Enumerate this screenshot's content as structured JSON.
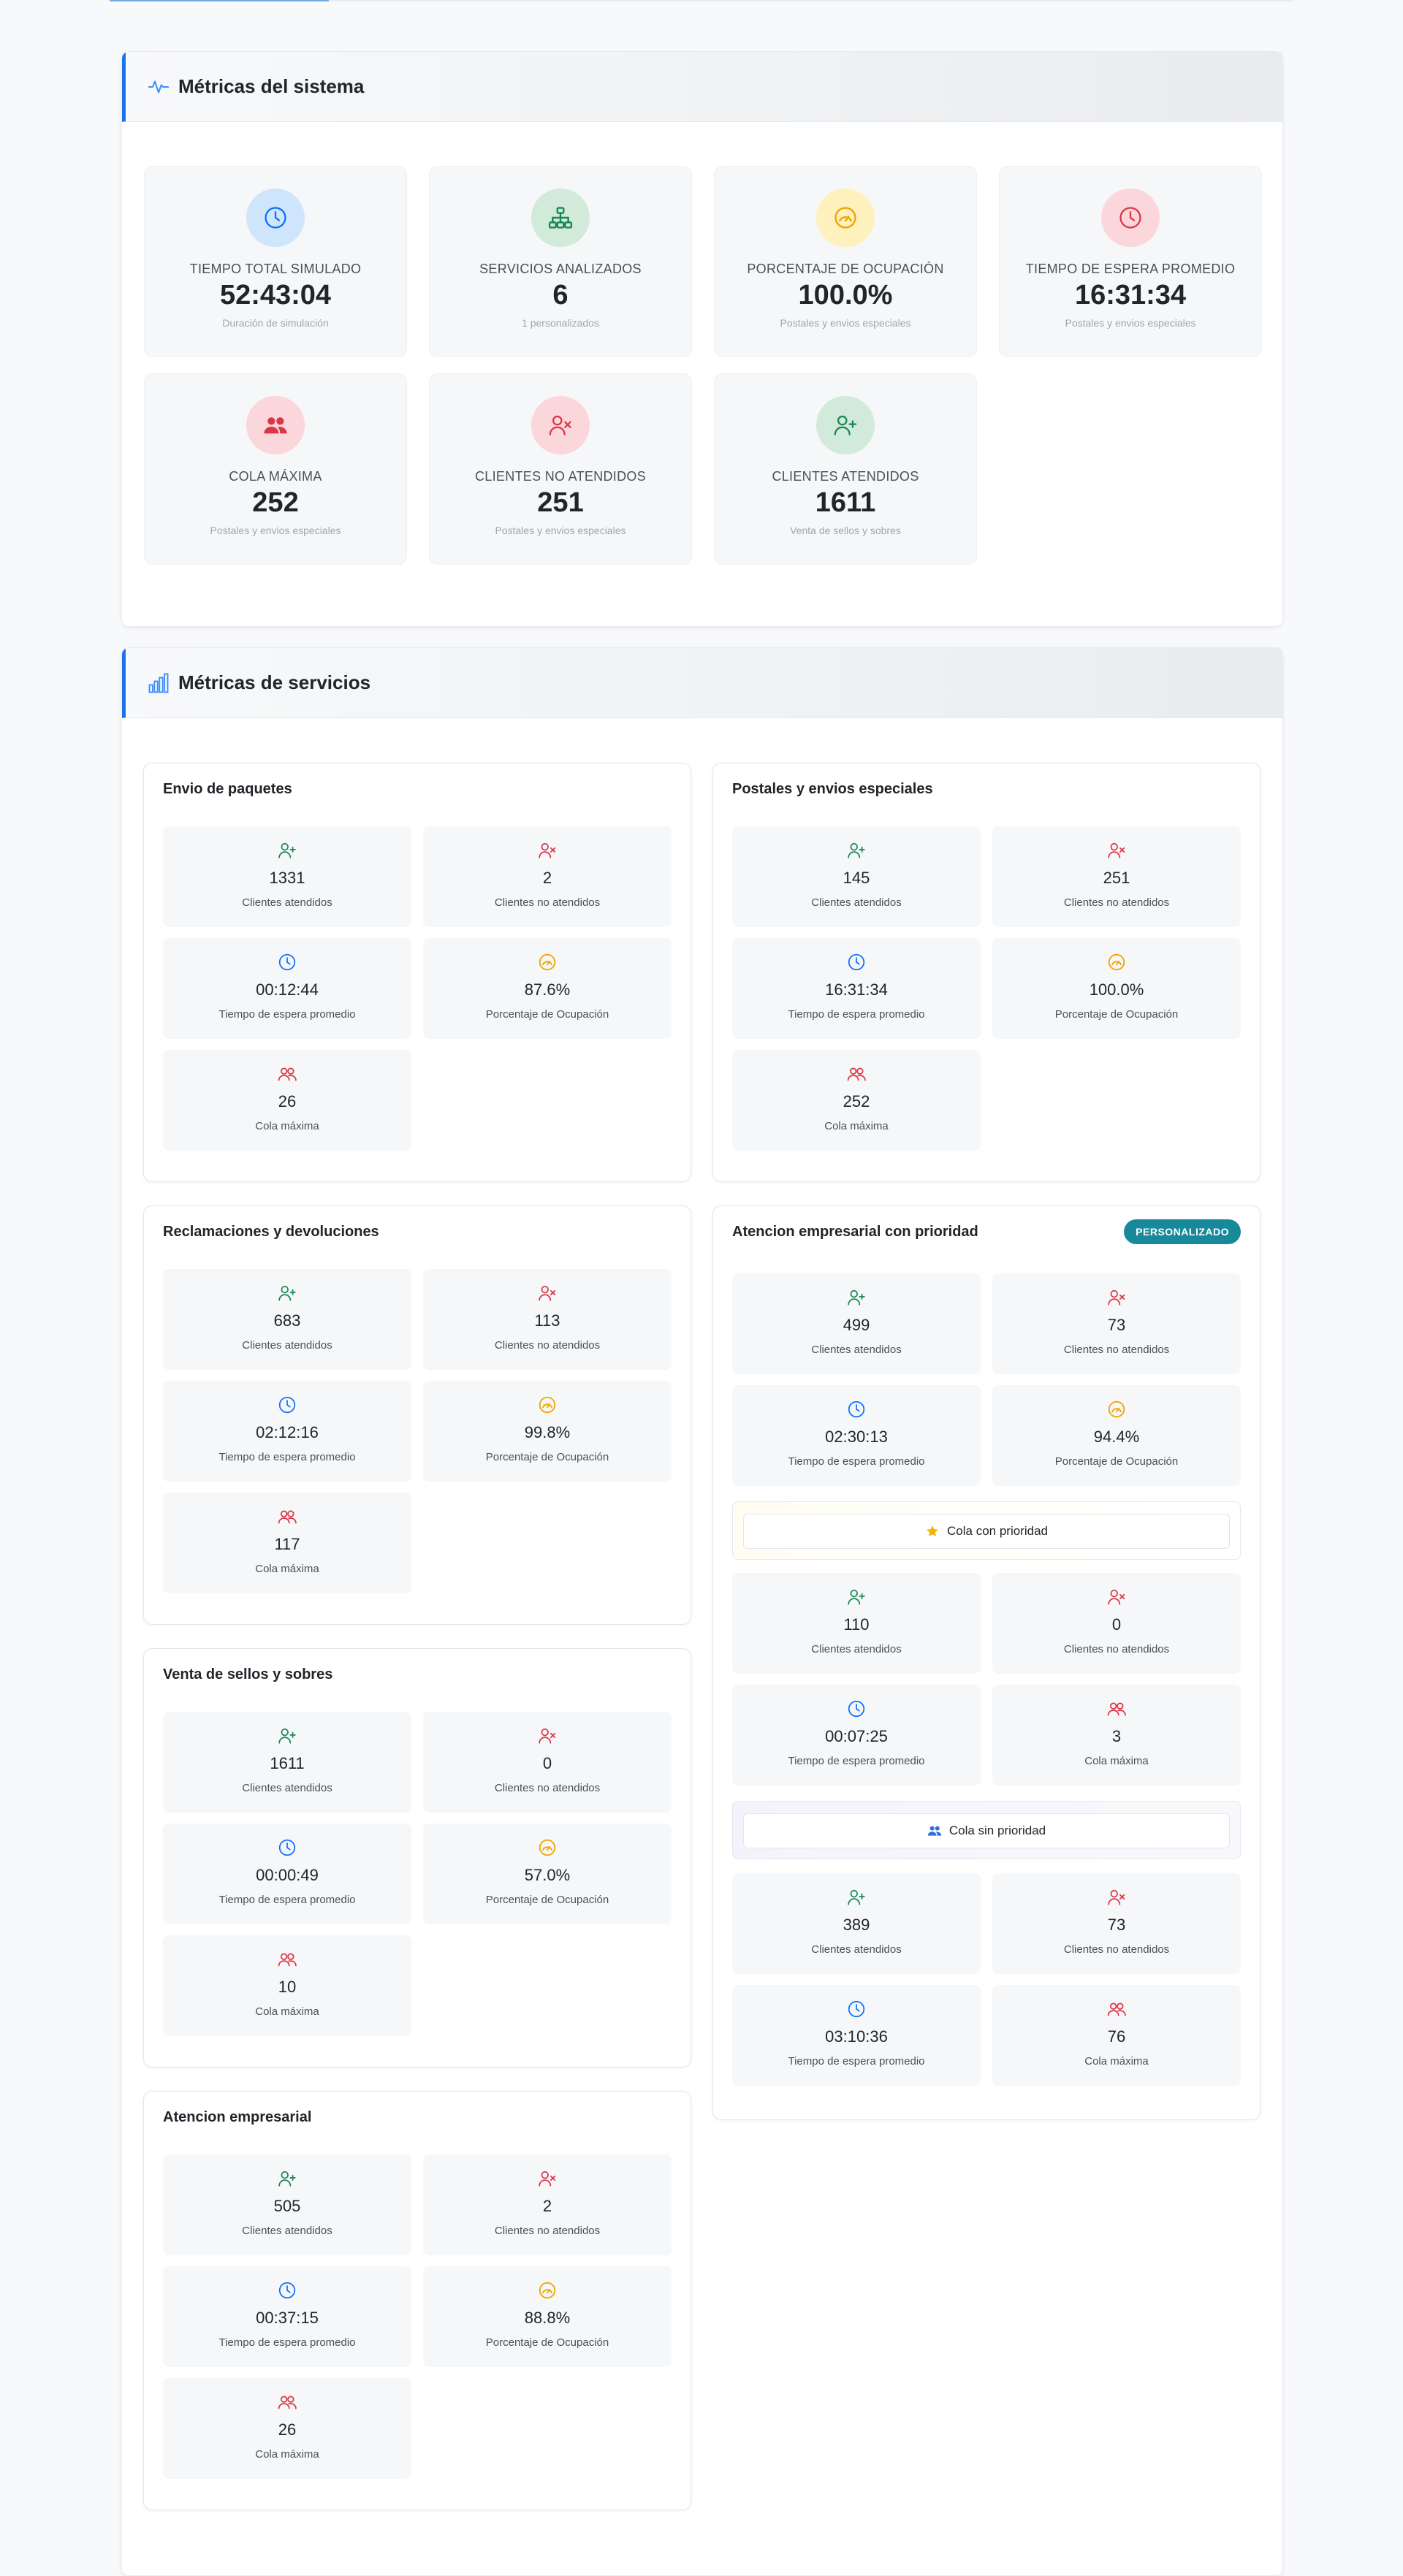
{
  "system": {
    "title": "Métricas del sistema",
    "tiles": [
      {
        "icon": "clock-icon",
        "label": "TIEMPO TOTAL SIMULADO",
        "value": "52:43:04",
        "sub": "Duración de simulación"
      },
      {
        "icon": "sitemap-icon",
        "label": "SERVICIOS ANALIZADOS",
        "value": "6",
        "sub": "1 personalizados"
      },
      {
        "icon": "gauge-icon",
        "label": "PORCENTAJE DE OCUPACIÓN",
        "value": "100.0%",
        "sub": "Postales y envios especiales"
      },
      {
        "icon": "clock-icon",
        "label": "TIEMPO DE ESPERA PROMEDIO",
        "value": "16:31:34",
        "sub": "Postales y envios especiales"
      },
      {
        "icon": "users-icon",
        "label": "COLA MÁXIMA",
        "value": "252",
        "sub": "Postales y envios especiales"
      },
      {
        "icon": "user-x-icon",
        "label": "CLIENTES NO ATENDIDOS",
        "value": "251",
        "sub": "Postales y envios especiales"
      },
      {
        "icon": "user-plus-icon",
        "label": "CLIENTES ATENDIDOS",
        "value": "1611",
        "sub": "Venta de sellos y sobres"
      }
    ]
  },
  "services": {
    "title": "Métricas de servicios",
    "labels": {
      "attended": "Clientes atendidos",
      "not_attended": "Clientes no atendidos",
      "wait": "Tiempo de espera promedio",
      "occupancy": "Porcentaje de Ocupación",
      "max_queue": "Cola máxima"
    },
    "envio": {
      "title": "Envio de paquetes",
      "attended": "1331",
      "not_attended": "2",
      "wait": "00:12:44",
      "occupancy": "87.6%",
      "max_queue": "26"
    },
    "reclamaciones": {
      "title": "Reclamaciones y devoluciones",
      "attended": "683",
      "not_attended": "113",
      "wait": "02:12:16",
      "occupancy": "99.8%",
      "max_queue": "117"
    },
    "venta": {
      "title": "Venta de sellos y sobres",
      "attended": "1611",
      "not_attended": "0",
      "wait": "00:00:49",
      "occupancy": "57.0%",
      "max_queue": "10"
    },
    "atencion": {
      "title": "Atencion empresarial",
      "attended": "505",
      "not_attended": "2",
      "wait": "00:37:15",
      "occupancy": "88.8%",
      "max_queue": "26"
    },
    "postales": {
      "title": "Postales y envios especiales",
      "attended": "145",
      "not_attended": "251",
      "wait": "16:31:34",
      "occupancy": "100.0%",
      "max_queue": "252"
    },
    "prioridad": {
      "title": "Atencion empresarial con prioridad",
      "badge": "PERSONALIZADO",
      "attended": "499",
      "not_attended": "73",
      "wait": "02:30:13",
      "occupancy": "94.4%",
      "priority_queue": {
        "label": "Cola con prioridad",
        "attended": "110",
        "not_attended": "0",
        "wait": "00:07:25",
        "max_queue": "3"
      },
      "normal_queue": {
        "label": "Cola sin prioridad",
        "attended": "389",
        "not_attended": "73",
        "wait": "03:10:36",
        "max_queue": "76"
      }
    }
  },
  "colors": {
    "accent": "#1a73e8",
    "success": "#198754",
    "danger": "#dc3545",
    "info": "#0d6efd",
    "warning": "#ffc107",
    "badge": "#17899a"
  }
}
